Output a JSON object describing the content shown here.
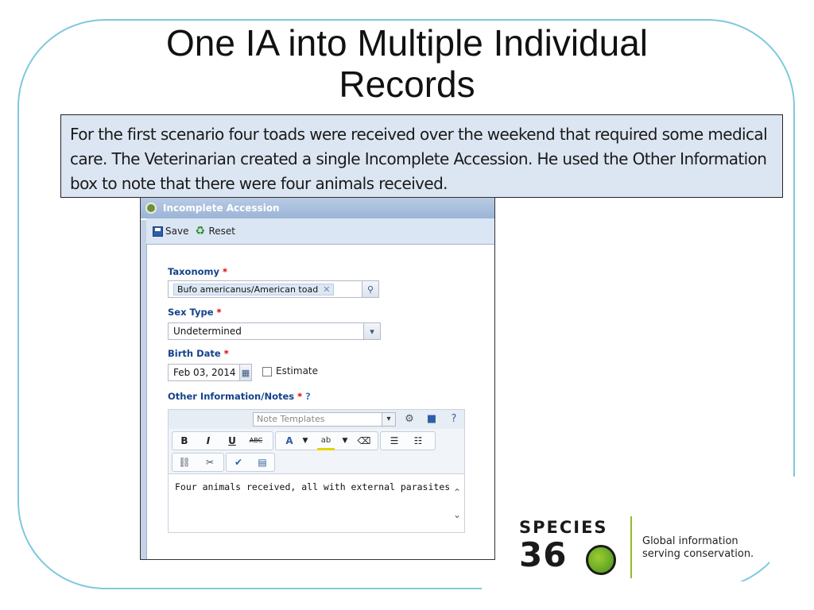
{
  "slide": {
    "title_line1": "One IA into Multiple Individual",
    "title_line2": "Records",
    "description": "For the first scenario four toads were received over the weekend that required some medical care. The Veterinarian created a single Incomplete Accession. He used the Other Information box to note that there were four animals received."
  },
  "window": {
    "title": "Incomplete Accession",
    "toolbar": {
      "save_label": "Save",
      "reset_label": "Reset"
    },
    "form": {
      "taxonomy_label": "Taxonomy",
      "taxonomy_value": "Bufo americanus/American toad",
      "sex_label": "Sex Type",
      "sex_value": "Undetermined",
      "birth_label": "Birth Date",
      "birth_value": "Feb 03, 2014",
      "estimate_label": "Estimate",
      "notes_label": "Other Information/Notes",
      "required_mark": "*",
      "note_templates_placeholder": "Note Templates",
      "notes_text": "Four animals received, all with external parasites"
    },
    "editor_buttons": {
      "bold": "B",
      "italic": "I",
      "underline": "U",
      "strike": "ABC"
    }
  },
  "logo": {
    "wordmark": "SPECIES",
    "number": "36",
    "tagline_line1": "Global information",
    "tagline_line2": "serving conservation."
  },
  "colors": {
    "frame": "#7ec8de",
    "desc_bg": "#dce6f2",
    "label_blue": "#15428b",
    "logo_green": "#8cbf2f"
  }
}
